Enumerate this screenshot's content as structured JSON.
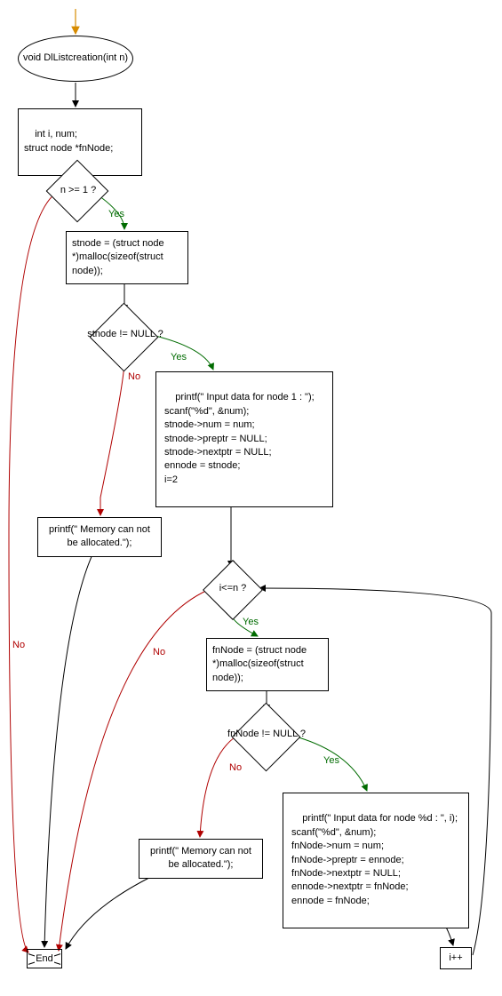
{
  "nodes": {
    "start": "void DlListcreation(int n)",
    "decls": "int i, num;\nstruct node *fnNode;",
    "cond_n": "n >= 1 ?",
    "alloc_stnode": "stnode = (struct node *)malloc(sizeof(struct node));",
    "cond_stnode": "stnode != NULL ?",
    "init_first": " printf(\" Input data for node 1 : \");\n scanf(\"%d\", &num);\n stnode->num = num;\n stnode->preptr = NULL;\n stnode->nextptr = NULL;\n ennode = stnode;\n i=2",
    "err1": "printf(\" Memory can not be allocated.\");",
    "cond_loop": "i<=n ?",
    "alloc_fnnode": "fnNode = (struct node *)malloc(sizeof(struct node));",
    "cond_fnnode": "fnNode != NULL ?",
    "init_next": " printf(\" Input data for node %d : \", i);\n scanf(\"%d\", &num);\n fnNode->num = num;\n fnNode->preptr = ennode;\n fnNode->nextptr = NULL;\n ennode->nextptr = fnNode;\n ennode = fnNode;",
    "err2": "printf(\" Memory can not be allocated.\");",
    "incr": "i++",
    "end": "End"
  },
  "labels": {
    "yes": "Yes",
    "no": "No"
  }
}
